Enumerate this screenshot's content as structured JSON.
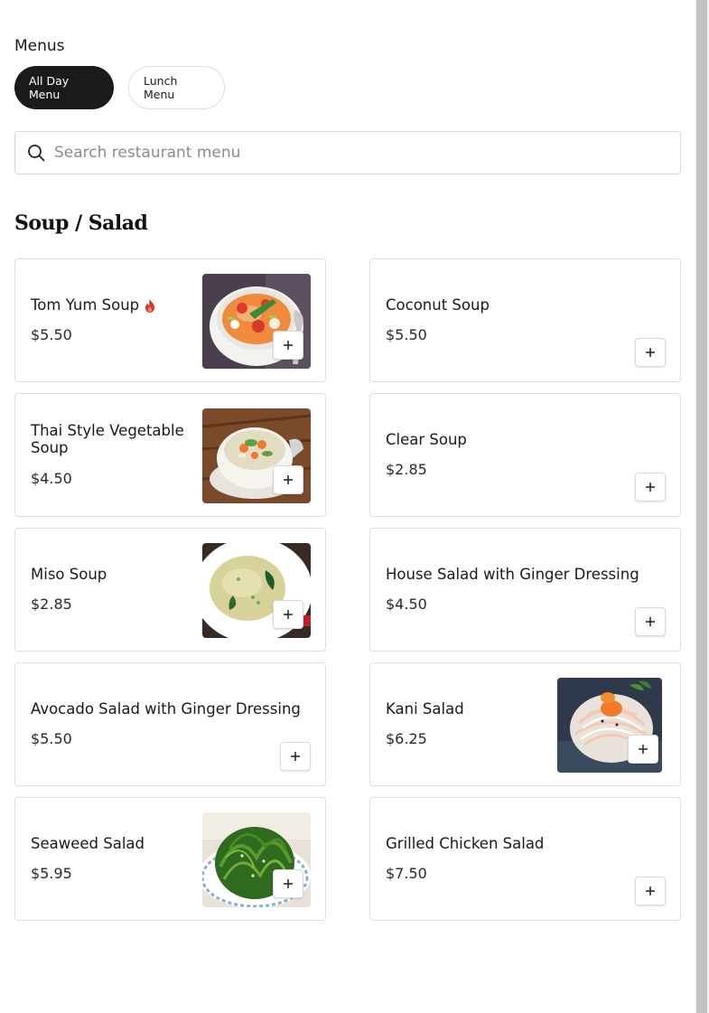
{
  "menus_label": "Menus",
  "menu_tabs": [
    "All Day Menu",
    "Lunch Menu"
  ],
  "search": {
    "placeholder": "Search restaurant menu"
  },
  "section": {
    "title": "Soup / Salad"
  },
  "items": [
    {
      "name": "Tom Yum Soup",
      "price": "$5.50",
      "spicy": true,
      "image": "tom-yum-soup"
    },
    {
      "name": "Coconut Soup",
      "price": "$5.50"
    },
    {
      "name": "Thai Style Vegetable Soup",
      "price": "$4.50",
      "image": "thai-vegetable-soup"
    },
    {
      "name": "Clear Soup",
      "price": "$2.85"
    },
    {
      "name": "Miso Soup",
      "price": "$2.85",
      "image": "miso-soup"
    },
    {
      "name": "House Salad with Ginger Dressing",
      "price": "$4.50"
    },
    {
      "name": "Avocado Salad with Ginger Dressing",
      "price": "$5.50"
    },
    {
      "name": "Kani Salad",
      "price": "$6.25",
      "image": "kani-salad"
    },
    {
      "name": "Seaweed Salad",
      "price": "$5.95",
      "image": "seaweed-salad"
    },
    {
      "name": "Grilled Chicken Salad",
      "price": "$7.50"
    }
  ],
  "colors": {
    "active_pill": "#1b1b1b",
    "border": "#dedede",
    "spicy": "#d23a2a"
  },
  "icons": {
    "search": "search-icon",
    "add": "plus-icon",
    "spicy": "flame-icon"
  }
}
